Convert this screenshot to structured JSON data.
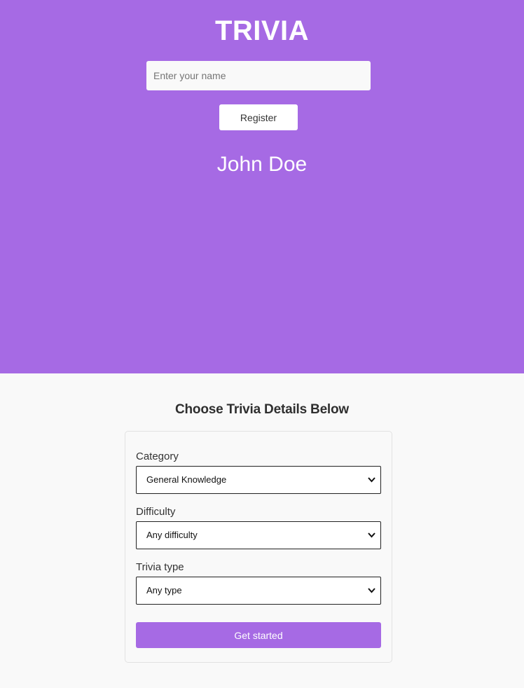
{
  "hero": {
    "title": "TRIVIA",
    "name_input": {
      "placeholder": "Enter your name",
      "value": ""
    },
    "register_label": "Register",
    "user_name": "John Doe"
  },
  "details": {
    "heading": "Choose Trivia Details Below",
    "category": {
      "label": "Category",
      "selected": "General Knowledge"
    },
    "difficulty": {
      "label": "Difficulty",
      "selected": "Any difficulty"
    },
    "type": {
      "label": "Trivia type",
      "selected": "Any type"
    },
    "start_label": "Get started"
  },
  "colors": {
    "accent": "#a66ae4",
    "background": "#f9f9f9",
    "text": "#333333"
  },
  "icons": {
    "dropdown": "chevron-down-icon"
  }
}
